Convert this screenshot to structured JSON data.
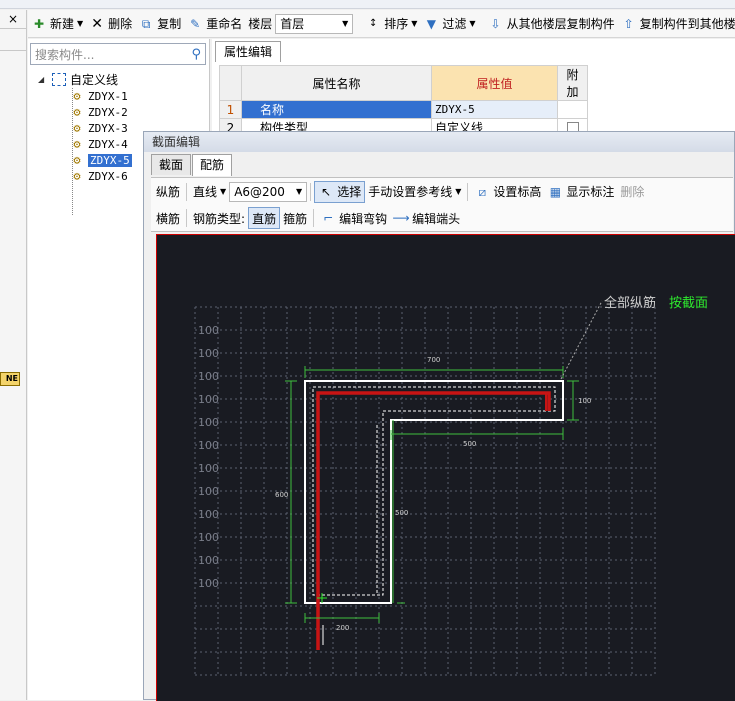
{
  "toolbar": {
    "new_label": "新建",
    "delete_label": "删除",
    "copy_label": "复制",
    "rename_label": "重命名",
    "floor_label": "楼层",
    "floor_value": "首层",
    "sort_label": "排序",
    "filter_label": "过滤",
    "copy_from_label": "从其他楼层复制构件",
    "copy_to_label": "复制构件到其他楼"
  },
  "left_panel": {
    "close_glyph": "×",
    "badge": "NE"
  },
  "search": {
    "placeholder": "搜索构件..."
  },
  "tree": {
    "root_label": "自定义线",
    "items": [
      {
        "label": "ZDYX-1"
      },
      {
        "label": "ZDYX-2"
      },
      {
        "label": "ZDYX-3"
      },
      {
        "label": "ZDYX-4"
      },
      {
        "label": "ZDYX-5",
        "selected": true
      },
      {
        "label": "ZDYX-6"
      }
    ]
  },
  "properties": {
    "tab": "属性编辑",
    "headers": {
      "name": "属性名称",
      "value": "属性值",
      "extra": "附加"
    },
    "rows": [
      {
        "num": "1",
        "name": "名称",
        "value": "ZDYX-5"
      },
      {
        "num": "2",
        "name": "构件类型",
        "value": "自定义线"
      }
    ]
  },
  "dialog": {
    "title": "截面编辑",
    "tabs": [
      "截面",
      "配筋"
    ],
    "active_tab": 1,
    "tb1": {
      "longitudinal": "纵筋",
      "line_type": "直线",
      "spec": "A6@200",
      "select": "选择",
      "manual_ref": "手动设置参考线",
      "set_elev": "设置标高",
      "show_dim": "显示标注",
      "remove": "删除"
    },
    "tb2": {
      "stirrup": "横筋",
      "bar_type_label": "钢筋类型:",
      "straight": "直筋",
      "hoop": "箍筋",
      "edit_hook": "编辑弯钩",
      "edit_end": "编辑端头"
    }
  },
  "canvas": {
    "grid_label": "100",
    "grid_label_count": 12,
    "annotation_all": "全部纵筋",
    "annotation_section": "按截面",
    "dims": {
      "top": "700",
      "right": "100",
      "inner": "500",
      "left": "600",
      "inner_vertical": "500",
      "bottom": "200"
    },
    "colors": {
      "background": "#191b22",
      "rebar": "#c81414",
      "outline": "#ffffff",
      "dimension": "#3fbf3f",
      "accent_text": "#2ee82e"
    }
  }
}
